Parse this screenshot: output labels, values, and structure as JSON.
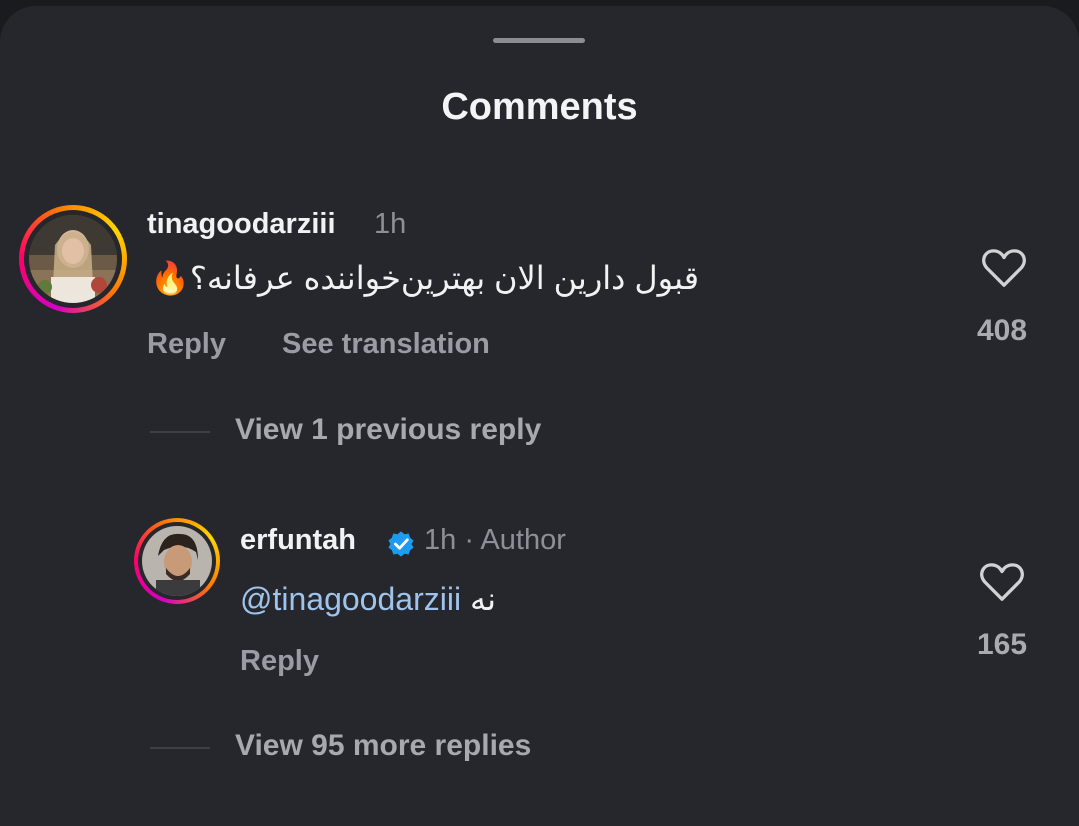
{
  "sheet": {
    "title": "Comments"
  },
  "comments": [
    {
      "username": "tinagoodarziii",
      "time": "1h",
      "text": "قبول دارین الان بهترین‌خواننده عرفانه؟🔥",
      "reply_label": "Reply",
      "translate_label": "See translation",
      "likes": "408",
      "view_replies": "View 1 previous reply"
    }
  ],
  "reply": {
    "username": "erfuntah",
    "verified": true,
    "meta": "1h · Author",
    "mention": "@tinagoodarziii",
    "text": "نه",
    "reply_label": "Reply",
    "likes": "165",
    "view_more": "View 95 more replies"
  },
  "icons": {
    "like": "heart-outline-icon",
    "verified": "verified-badge-icon"
  },
  "colors": {
    "background": "#25272c",
    "mention": "#9fc3ea",
    "verified": "#1d9bf0"
  }
}
